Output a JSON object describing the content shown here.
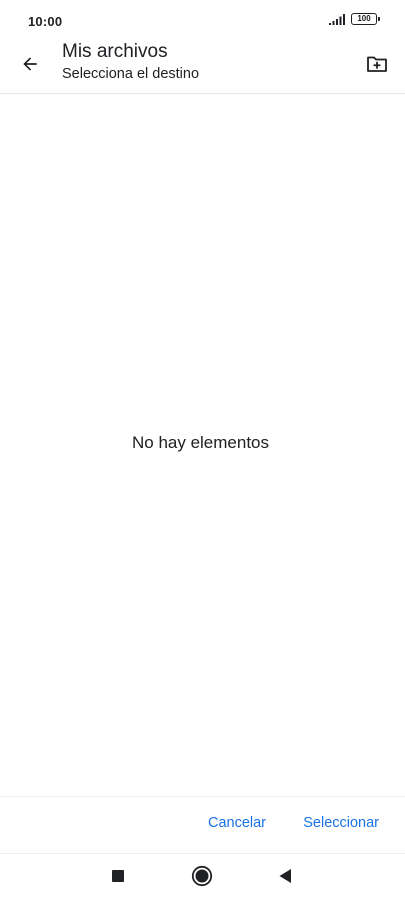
{
  "status_bar": {
    "time": "10:00",
    "battery_level": "100",
    "icons": [
      "signal-icon",
      "battery-icon"
    ]
  },
  "app_bar": {
    "title": "Mis archivos",
    "subtitle": "Selecciona el destino",
    "icons": [
      "arrow-left-icon",
      "create-folder-icon"
    ]
  },
  "content": {
    "empty_message": "No hay elementos"
  },
  "actions": {
    "cancel_label": "Cancelar",
    "select_label": "Seleccionar"
  },
  "nav_bar": {
    "icons": [
      "square-recents-icon",
      "circle-home-icon",
      "triangle-back-icon"
    ]
  },
  "colors": {
    "accent": "#1a73e8",
    "text": "#202124",
    "background": "#ffffff"
  }
}
